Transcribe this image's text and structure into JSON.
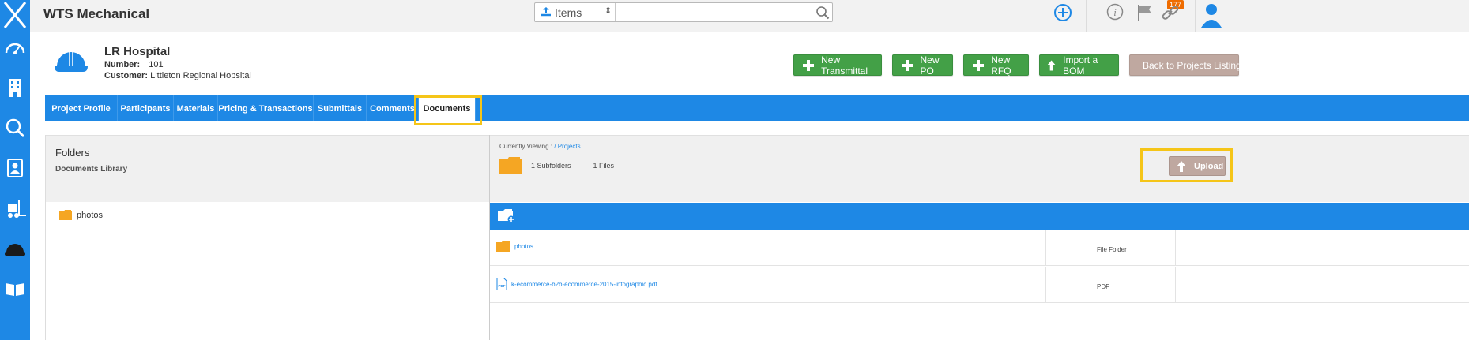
{
  "app": {
    "title": "WTS Mechanical"
  },
  "search": {
    "type_label": "Items",
    "placeholder": ""
  },
  "notifications": {
    "count": "177"
  },
  "project": {
    "name": "LR Hospital",
    "number_label": "Number:",
    "number": "101",
    "customer_label": "Customer:",
    "customer": "Littleton Regional Hopsital"
  },
  "actions": {
    "new_transmittal": "New Transmittal",
    "new_po": "New PO",
    "new_rfq": "New RFQ",
    "import_bom": "Import a BOM",
    "back": "Back to Projects Listing"
  },
  "tabs": [
    "Project Profile",
    "Participants",
    "Materials",
    "Pricing & Transactions",
    "Submittals",
    "Comments",
    "Documents"
  ],
  "active_tab": "Documents",
  "folders": {
    "title": "Folders",
    "library": "Documents Library",
    "items": [
      "photos"
    ]
  },
  "viewer": {
    "currently_viewing_label": "Currently Viewing :",
    "path_sep": "/",
    "path": "Projects",
    "subfolders": "1 Subfolders",
    "files": "1 Files",
    "upload_label": "Upload"
  },
  "files": [
    {
      "name": "photos",
      "type": "File Folder"
    },
    {
      "name": "k-ecommerce-b2b-ecommerce-2015-infographic.pdf",
      "type": "PDF"
    }
  ],
  "colors": {
    "primary": "#1e88e5",
    "success": "#43a047",
    "muted_button": "#bfa8a0",
    "highlight": "#f5c518",
    "folder": "#f5a623",
    "badge": "#ef6c00"
  }
}
